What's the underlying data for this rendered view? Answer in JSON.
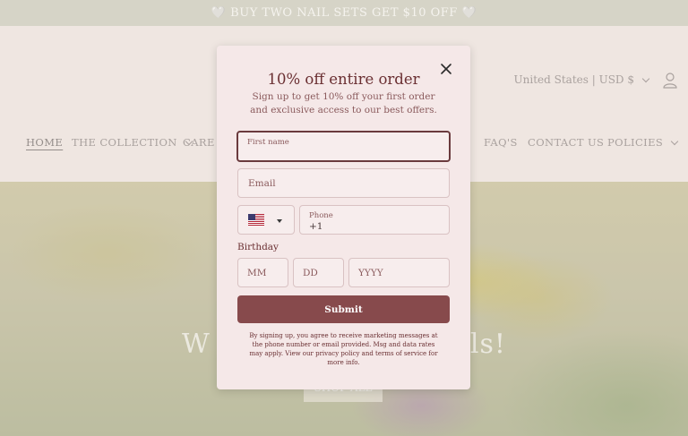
{
  "announcement": "🤍 BUY TWO NAIL SETS GET $10 OFF 🤍",
  "header": {
    "country_selector": "United States | USD $",
    "nav": [
      {
        "label": "HOME",
        "active": true,
        "dropdown": false
      },
      {
        "label": "THE COLLECTION",
        "active": false,
        "dropdown": true
      },
      {
        "label": "CARE &",
        "active": false,
        "dropdown": false
      },
      {
        "label": "FAQ'S",
        "active": false,
        "dropdown": false
      },
      {
        "label": "CONTACT US",
        "active": false,
        "dropdown": false
      },
      {
        "label": "POLICIES",
        "active": false,
        "dropdown": true
      }
    ]
  },
  "hero": {
    "title_left": "W",
    "title_right": "ls!",
    "button_label": "SHOP ALL"
  },
  "modal": {
    "title": "10% off entire order",
    "subtitle": "Sign up to get 10% off your first order and exclusive access to our best offers.",
    "first_name_label": "First name",
    "email_placeholder": "Email",
    "phone_label": "Phone",
    "phone_value": "+1",
    "birthday_label": "Birthday",
    "mm_placeholder": "MM",
    "dd_placeholder": "DD",
    "yyyy_placeholder": "YYYY",
    "submit_label": "Submit",
    "legal": "By signing up, you agree to receive marketing messages at the phone number or email provided. Msg and data rates may apply. View our privacy policy and terms of service for more info."
  },
  "colors": {
    "announcement_bg": "#d0d0c4",
    "modal_bg": "#f5e8e8",
    "accent": "#874a4c",
    "title": "#6a2f32"
  }
}
